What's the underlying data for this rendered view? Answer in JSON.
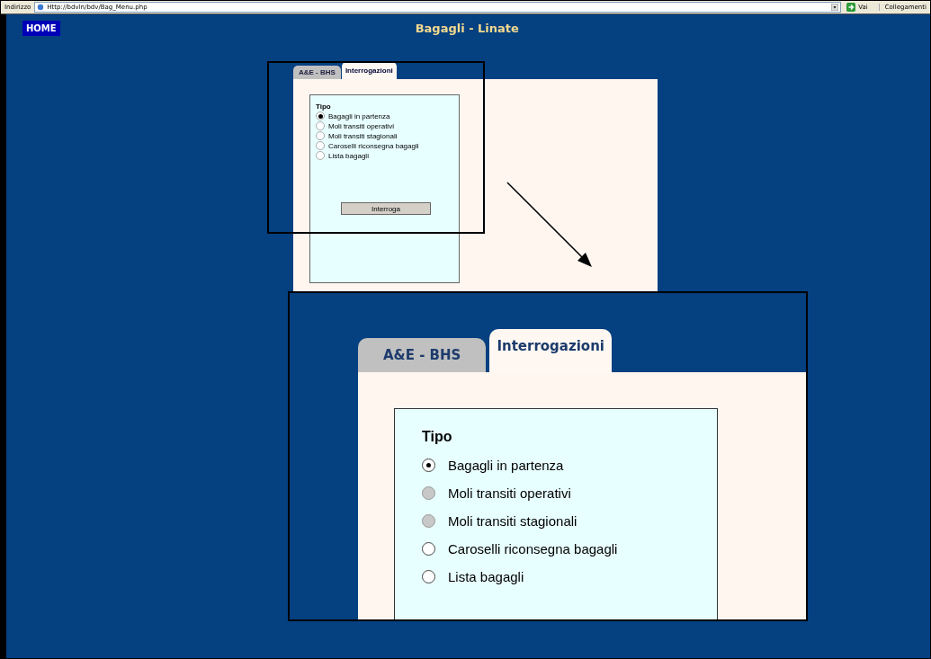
{
  "address_bar": {
    "label": "Indirizzo",
    "url": "Http://bdvln/bdv/Bag_Menu.php",
    "go": "Vai",
    "links": "Collegamenti"
  },
  "page": {
    "home": "HOME",
    "title": "Bagagli - Linate",
    "tabs": [
      {
        "label": "A&E - BHS",
        "selected": false
      },
      {
        "label": "Interrogazioni",
        "selected": true
      }
    ],
    "legend": "Tipo",
    "options": [
      {
        "label": "Bagagli in partenza",
        "selected": true,
        "disabled": false
      },
      {
        "label": "Moli transiti operativi",
        "selected": false,
        "disabled": false
      },
      {
        "label": "Moli transiti stagionali",
        "selected": false,
        "disabled": false
      },
      {
        "label": "Caroselli riconsegna bagagli",
        "selected": false,
        "disabled": false
      },
      {
        "label": "Lista bagagli",
        "selected": false,
        "disabled": false
      }
    ],
    "button": "Interroga"
  },
  "zoom_inset": {
    "tabs": [
      {
        "label": "A&E - BHS",
        "selected": false
      },
      {
        "label": "Interrogazioni",
        "selected": true
      }
    ],
    "legend": "Tipo",
    "options": [
      {
        "label": "Bagagli in partenza",
        "selected": true,
        "disabled": false
      },
      {
        "label": "Moli transiti operativi",
        "selected": false,
        "disabled": true
      },
      {
        "label": "Moli transiti stagionali",
        "selected": false,
        "disabled": true
      },
      {
        "label": "Caroselli riconsegna bagagli",
        "selected": false,
        "disabled": false
      },
      {
        "label": "Lista bagagli",
        "selected": false,
        "disabled": false
      }
    ]
  }
}
